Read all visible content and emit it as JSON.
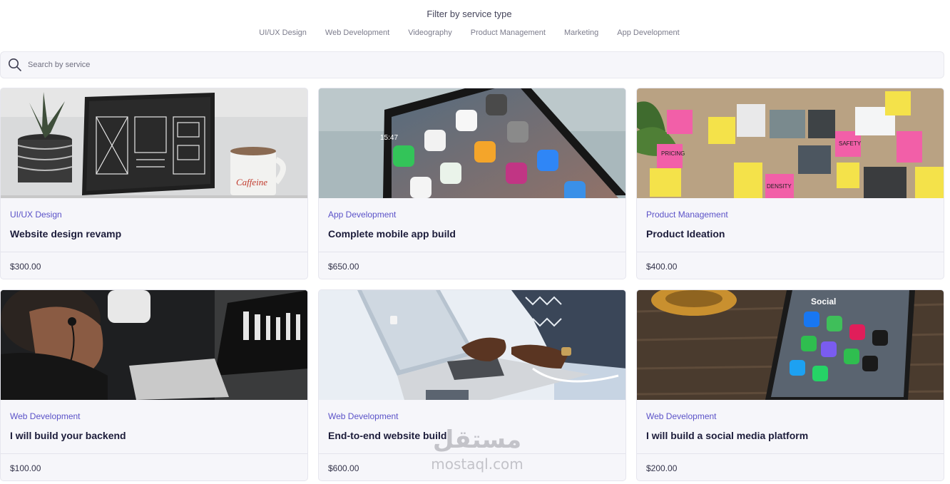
{
  "filter": {
    "title": "Filter by service type",
    "options": [
      "UI/UX Design",
      "Web Development",
      "Videography",
      "Product Management",
      "Marketing",
      "App Development"
    ]
  },
  "search": {
    "placeholder": "Search by service",
    "value": ""
  },
  "cards": [
    {
      "category": "UI/UX Design",
      "title": "Website design revamp",
      "price": "$300.00",
      "image": "tablet-wireframe-coffee"
    },
    {
      "category": "App Development",
      "title": "Complete mobile app build",
      "price": "$650.00",
      "image": "smartphone-app-icons"
    },
    {
      "category": "Product Management",
      "title": "Product Ideation",
      "price": "$400.00",
      "image": "sticky-notes-board"
    },
    {
      "category": "Web Development",
      "title": "I will build your backend",
      "price": "$100.00",
      "image": "developer-drinking-coffee"
    },
    {
      "category": "Web Development",
      "title": "End-to-end website build",
      "price": "$600.00",
      "image": "typing-on-laptop"
    },
    {
      "category": "Web Development",
      "title": "I will build a social media platform",
      "price": "$200.00",
      "image": "phone-social-apps"
    }
  ],
  "watermark": {
    "arabic": "مستقل",
    "latin": "mostaql.com"
  },
  "colors": {
    "accent": "#5b52c8",
    "card_bg": "#f6f6fa",
    "title": "#1c1c3a"
  }
}
